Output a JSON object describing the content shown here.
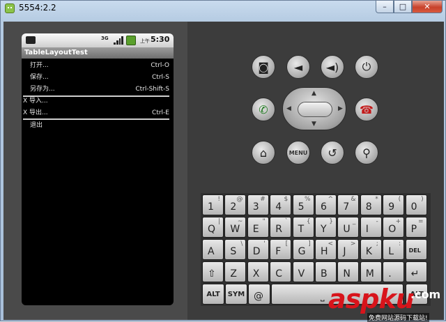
{
  "window": {
    "title": "5554:2.2",
    "minimize": "–",
    "maximize": "□",
    "close": "✕"
  },
  "statusbar": {
    "network": "3G",
    "ampm": "上午",
    "clock": "5:30"
  },
  "app": {
    "title": "TableLayoutTest"
  },
  "menu_rows": [
    {
      "label": "打开...",
      "shortcut": "Ctrl-O"
    },
    {
      "label": "保存...",
      "shortcut": "Ctrl-S"
    },
    {
      "label": "另存为...",
      "shortcut": "Ctrl-Shift-S"
    },
    {
      "label": "X 导入...",
      "shortcut": ""
    },
    {
      "label": "X 导出...",
      "shortcut": "Ctrl-E"
    },
    {
      "label": "退出",
      "shortcut": ""
    }
  ],
  "controls": {
    "camera": "camera-icon",
    "volume_down": "volume-down-icon",
    "volume_up": "volume-up-icon",
    "power": "power-icon",
    "call": "call-icon",
    "end_call": "end-call-icon",
    "home": "home-icon",
    "menu_label": "MENU",
    "back": "back-icon",
    "search": "search-icon"
  },
  "keyboard": {
    "row1": [
      [
        "1",
        "!"
      ],
      [
        "2",
        "@"
      ],
      [
        "3",
        "#"
      ],
      [
        "4",
        "$"
      ],
      [
        "5",
        "%"
      ],
      [
        "6",
        "^"
      ],
      [
        "7",
        "&"
      ],
      [
        "8",
        "*"
      ],
      [
        "9",
        "("
      ],
      [
        "0",
        ")"
      ]
    ],
    "row2": [
      [
        "Q",
        "|"
      ],
      [
        "W",
        "~"
      ],
      [
        "E",
        "\""
      ],
      [
        "R",
        "`"
      ],
      [
        "T",
        "{"
      ],
      [
        "Y",
        "}"
      ],
      [
        "U",
        "_"
      ],
      [
        "I",
        "-"
      ],
      [
        "O",
        "+"
      ],
      [
        "P",
        "="
      ]
    ],
    "row3": [
      [
        "A",
        ""
      ],
      [
        "S",
        "\\"
      ],
      [
        "D",
        "'"
      ],
      [
        "F",
        "["
      ],
      [
        "G",
        "]"
      ],
      [
        "H",
        "<"
      ],
      [
        "J",
        ">"
      ],
      [
        "K",
        ";"
      ],
      [
        "L",
        ":"
      ],
      [
        "DEL",
        ""
      ]
    ],
    "row4": [
      [
        "⇧",
        ""
      ],
      [
        "Z",
        ""
      ],
      [
        "X",
        ""
      ],
      [
        "C",
        ""
      ],
      [
        "V",
        ""
      ],
      [
        "B",
        ""
      ],
      [
        "N",
        ""
      ],
      [
        "M",
        ""
      ],
      [
        ".",
        ""
      ],
      [
        "↵",
        ""
      ]
    ],
    "alt_label": "ALT",
    "sym_label": "SYM",
    "at_label": "@",
    "space_label": "⎵",
    "alt2_label": "ALT"
  },
  "watermark": {
    "logo": "aspku",
    "dot": ".com",
    "sub": "免费网站源码下载站!"
  }
}
